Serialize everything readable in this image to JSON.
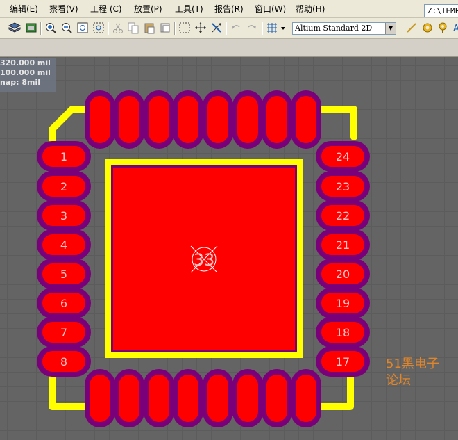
{
  "menu": [
    {
      "label": "编辑(E)"
    },
    {
      "label": "察看(V)"
    },
    {
      "label": "工程 (C)"
    },
    {
      "label": "放置(P)"
    },
    {
      "label": "工具(T)"
    },
    {
      "label": "报告(R)"
    },
    {
      "label": "窗口(W)"
    },
    {
      "label": "帮助(H)"
    }
  ],
  "path_box": "Z:\\TEMP",
  "view_select": "Altium Standard 2D",
  "hud": {
    "x": "320.000 mil",
    "y": "100.000 mil",
    "snap": "nap: 8mil"
  },
  "pcb": {
    "left_pads": [
      "1",
      "2",
      "3",
      "4",
      "5",
      "6",
      "7",
      "8"
    ],
    "right_pads": [
      "24",
      "23",
      "22",
      "21",
      "20",
      "19",
      "18",
      "17"
    ],
    "center_pad": "33",
    "colors": {
      "pad": "#ff0000",
      "solder_mask": "#7a007a",
      "silkscreen": "#ffff00",
      "pad_text": "#ffc0c0"
    }
  },
  "watermark": {
    "line1": "51黑电子",
    "line2": "论坛"
  }
}
